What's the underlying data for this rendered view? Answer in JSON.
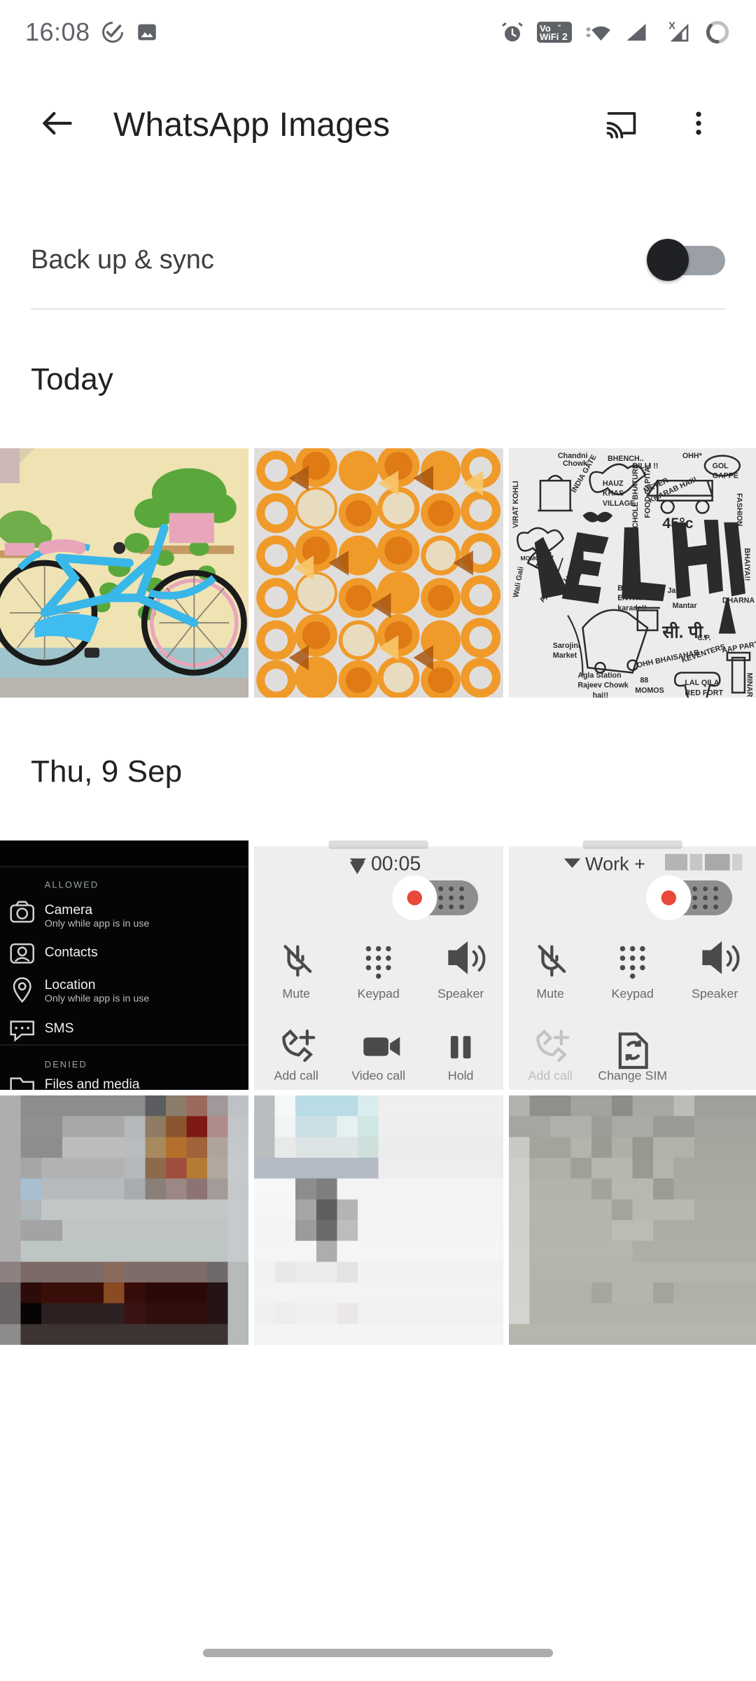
{
  "status_bar": {
    "time": "16:08",
    "left_icons": [
      "check-circle-icon",
      "image-icon"
    ],
    "right_icons": [
      "alarm-icon",
      "vowifi2-icon",
      "wifi-icon",
      "signal-icon",
      "signal-no-sim-icon",
      "battery-ring-icon"
    ],
    "vowifi_label_top": "Vo",
    "vowifi_label_bottom": "WiFi",
    "vowifi_superscript": "2",
    "no_sim_mark": "X"
  },
  "app_bar": {
    "back_label": "Back",
    "title": "WhatsApp Images",
    "cast_label": "Cast",
    "overflow_label": "More options"
  },
  "backup": {
    "label": "Back up & sync",
    "enabled": false,
    "toggle_state": "off"
  },
  "sections": [
    {
      "id": "today",
      "title": "Today"
    },
    {
      "id": "thu",
      "title": "Thu, 9 Sep"
    }
  ],
  "colors": {
    "text_primary": "#202124",
    "text_secondary": "#5f6368",
    "divider": "#e3e3e3",
    "toggle_track_off": "#9aa0a6",
    "toggle_thumb_off": "#202124",
    "background": "#ffffff",
    "nav_pill": "#adadad"
  },
  "grid": {
    "columns": 3,
    "rows": [
      {
        "section": "today",
        "tiles": [
          {
            "name": "photo-bicycle-wall-planter",
            "alt": "Blue bicycle mounted on cream wall with pink plant pots"
          },
          {
            "name": "photo-orange-slices-pattern",
            "alt": "Grid pattern of orange slices and peels"
          },
          {
            "name": "photo-delhi-doodle-art",
            "alt": "Hand drawn Delhi doodle art on paper"
          }
        ]
      },
      {
        "section": "thu",
        "tiles": [
          {
            "name": "screenshot-app-permissions",
            "alt": "Dark app permissions settings screen"
          },
          {
            "name": "screenshot-call-timer",
            "alt": "In-call screen with call timer"
          },
          {
            "name": "screenshot-call-work-sim",
            "alt": "In-call screen for Work SIM"
          }
        ]
      },
      {
        "section": "thu",
        "tiles": [
          {
            "name": "photo-blurred-thumbnail-1",
            "alt": "Low resolution blurred thumbnail"
          },
          {
            "name": "photo-blurred-thumbnail-2",
            "alt": "Low resolution blurred thumbnail"
          },
          {
            "name": "photo-blurred-thumbnail-3",
            "alt": "Low resolution blurred thumbnail"
          }
        ]
      }
    ]
  },
  "screenshot_permissions": {
    "group_allowed": "ALLOWED",
    "group_denied": "DENIED",
    "allowed_items": [
      {
        "icon": "camera-icon",
        "label": "Camera",
        "sub": "Only while app is in use"
      },
      {
        "icon": "contacts-icon",
        "label": "Contacts",
        "sub": ""
      },
      {
        "icon": "location-icon",
        "label": "Location",
        "sub": "Only while app is in use"
      },
      {
        "icon": "sms-icon",
        "label": "SMS",
        "sub": ""
      }
    ],
    "denied_items": [
      {
        "icon": "folder-icon",
        "label": "Files and media",
        "sub": ""
      }
    ]
  },
  "screenshot_call_a": {
    "duration": "00:05",
    "network_icon": "wifi-call-icon",
    "record_toggle": "record-toggle",
    "buttons": [
      {
        "icon": "mic-off-icon",
        "label": "Mute",
        "disabled": false
      },
      {
        "icon": "keypad-icon",
        "label": "Keypad",
        "disabled": false
      },
      {
        "icon": "speaker-icon",
        "label": "Speaker",
        "disabled": false
      },
      {
        "icon": "add-call-icon",
        "label": "Add call",
        "disabled": false
      },
      {
        "icon": "video-call-icon",
        "label": "Video call",
        "disabled": false
      },
      {
        "icon": "hold-icon",
        "label": "Hold",
        "disabled": false
      }
    ]
  },
  "screenshot_call_b": {
    "sim_label": "Work +",
    "number_redacted": true,
    "network_icon": "wifi-call-icon",
    "record_toggle": "record-toggle",
    "buttons": [
      {
        "icon": "mic-off-icon",
        "label": "Mute",
        "disabled": false
      },
      {
        "icon": "keypad-icon",
        "label": "Keypad",
        "disabled": false
      },
      {
        "icon": "speaker-icon",
        "label": "Speaker",
        "disabled": false
      },
      {
        "icon": "add-call-icon",
        "label": "Add call",
        "disabled": true
      },
      {
        "icon": "change-sim-icon",
        "label": "Change SIM",
        "disabled": false
      }
    ]
  },
  "navigation": {
    "pill_label": "Home gesture bar"
  }
}
